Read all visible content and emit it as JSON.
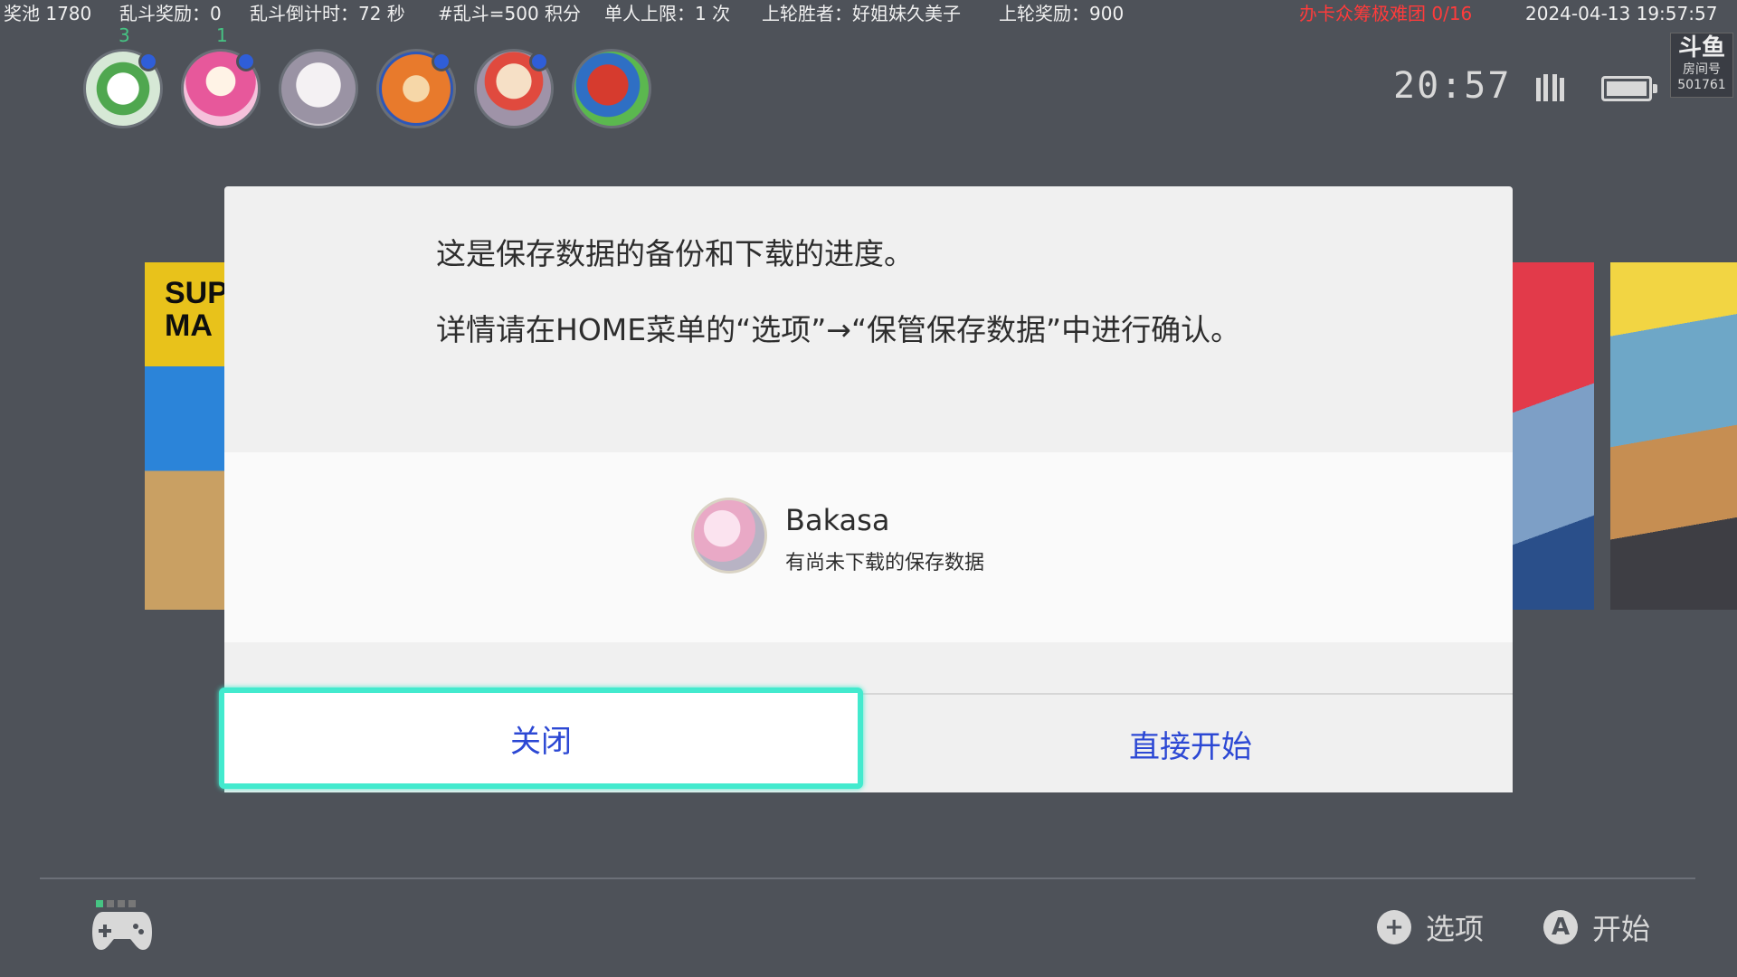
{
  "overlay": {
    "prize_pool": "奖池 1780",
    "brawl_reward": "乱斗奖励：0",
    "brawl_countdown": "乱斗倒计时：72 秒",
    "brawl_points": "#乱斗=500 积分",
    "per_person_limit": "单人上限：1 次",
    "last_winner": "上轮胜者：好姐妹久美子",
    "last_reward": "上轮奖励：900",
    "card_campaign": "办卡众筹极难团 0/16",
    "datetime": "2024-04-13 19:57:57"
  },
  "users": [
    {
      "name": "yoshi-egg",
      "count": "3",
      "color": "#cfe9d2"
    },
    {
      "name": "toadette",
      "count": "1",
      "color": "#f3b4d6"
    },
    {
      "name": "anime-white-hair",
      "count": "",
      "color": "#d7d2d6"
    },
    {
      "name": "waddle-dee",
      "count": "",
      "color": "#f08a3a"
    },
    {
      "name": "captain-toad",
      "count": "",
      "color": "#e7c8a6"
    },
    {
      "name": "mario-yoshi",
      "count": "",
      "color": "#e24b3b"
    }
  ],
  "status": {
    "time": "20:57",
    "room_logo": "斗鱼",
    "room_label": "房间号",
    "room_number": "501761"
  },
  "background_tile": {
    "left_text": "SUP\nMA"
  },
  "dialog": {
    "message_line1": "这是保存数据的备份和下载的进度。",
    "message_line2": "详情请在HOME菜单的“选项”→“保管保存数据”中进行确认。",
    "user_name": "Bakasa",
    "user_status": "有尚未下载的保存数据",
    "close_button": "关闭",
    "start_button": "直接开始"
  },
  "footer": {
    "options_glyph": "+",
    "options_label": "选项",
    "start_glyph": "A",
    "start_label": "开始"
  },
  "colors": {
    "accent_focus": "#43eace",
    "button_text": "#2c48d4",
    "background": "#4e5259"
  }
}
